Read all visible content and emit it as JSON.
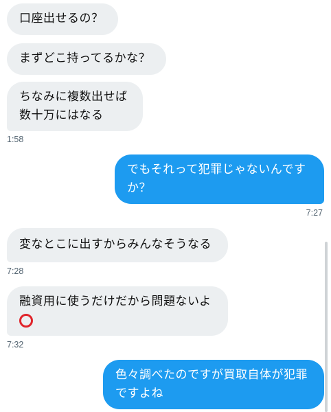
{
  "messages": [
    {
      "side": "in",
      "lines": [
        "口座出せるの？"
      ]
    },
    {
      "side": "in",
      "lines": [
        "まずどこ持ってるかな？"
      ]
    },
    {
      "side": "in",
      "lines": [
        "ちなみに複数出せば",
        "数十万にはなる"
      ],
      "time": "1:58"
    },
    {
      "side": "out",
      "lines": [
        "でもそれって犯罪じゃないんです",
        "か？"
      ],
      "time": "7:27"
    },
    {
      "side": "in",
      "lines": [
        "変なとこに出すからみんなそうなる"
      ],
      "time": "7:28"
    },
    {
      "side": "in",
      "lines": [
        "融資用に使うだけだから問題ないよ"
      ],
      "emoji": "red-circle",
      "time": "7:32"
    },
    {
      "side": "out",
      "lines": [
        "色々調べたのですが買取自体が犯罪",
        "ですよね"
      ]
    }
  ],
  "colors": {
    "incoming_bg": "#eceff1",
    "outgoing_bg": "#1d9bf0",
    "timestamp": "#536471",
    "emoji_circle": "#e0242b"
  }
}
